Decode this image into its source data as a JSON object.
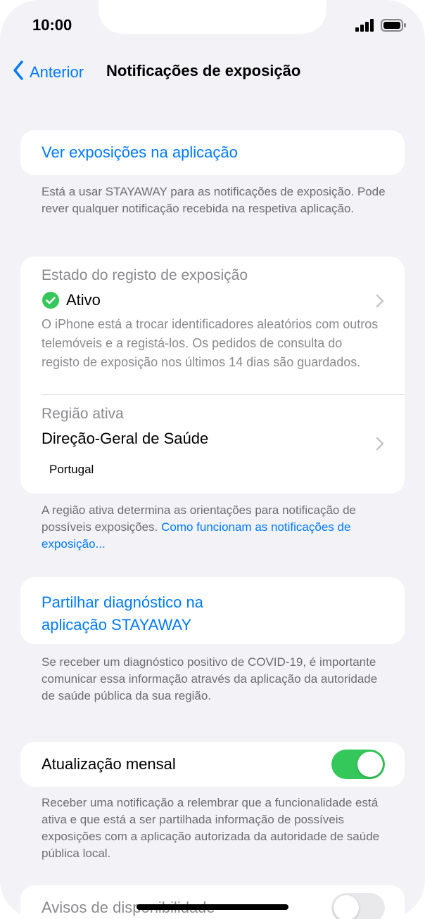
{
  "status": {
    "time": "10:00"
  },
  "nav": {
    "back_label": "Anterior",
    "title": "Notificações de exposição"
  },
  "view_in_app": {
    "label": "Ver exposições na aplicação",
    "footer": "Está a usar STAYAWAY para as notificações de exposição. Pode rever qualquer notificação recebida na respetiva aplicação."
  },
  "exposure_log": {
    "label": "Estado do registo de exposição",
    "status": "Ativo",
    "description": "O iPhone está a trocar identificadores aleatórios com outros telemóveis e a registá-los. Os pedidos de consulta do registo de exposição nos últimos 14 dias são guardados."
  },
  "region": {
    "label": "Região ativa",
    "name": "Direção-Geral de Saúde",
    "country": "Portugal",
    "footer_text": "A região ativa determina as orientações para notificação de possíveis exposições. ",
    "footer_link": "Como funcionam as notificações de exposição..."
  },
  "share_diagnosis": {
    "line1": "Partilhar diagnóstico na",
    "line2": "aplicação STAYAWAY",
    "footer": "Se receber um diagnóstico positivo de COVID-19, é importante comunicar essa informação através da aplicação da autoridade de saúde pública da sua região."
  },
  "monthly_update": {
    "label": "Atualização mensal",
    "enabled": true,
    "footer": "Receber uma notificação a relembrar que a funcionalidade está ativa e que está a ser partilhada informação de possíveis exposições com a aplicação autorizada da autoridade de saúde pública local."
  },
  "availability_alerts": {
    "label": "Avisos de disponibilidade",
    "enabled": false
  },
  "colors": {
    "accent": "#007aff",
    "toggle_on": "#34c759",
    "toggle_off": "#e9e9eb",
    "check_green": "#34c759",
    "background": "#f2f2f7"
  },
  "icons": {
    "back": "chevron-left-icon",
    "row_disclosure": "chevron-right-icon",
    "status": "checkmark-circle-icon",
    "signal": "signal-bars-icon",
    "battery": "battery-icon"
  }
}
